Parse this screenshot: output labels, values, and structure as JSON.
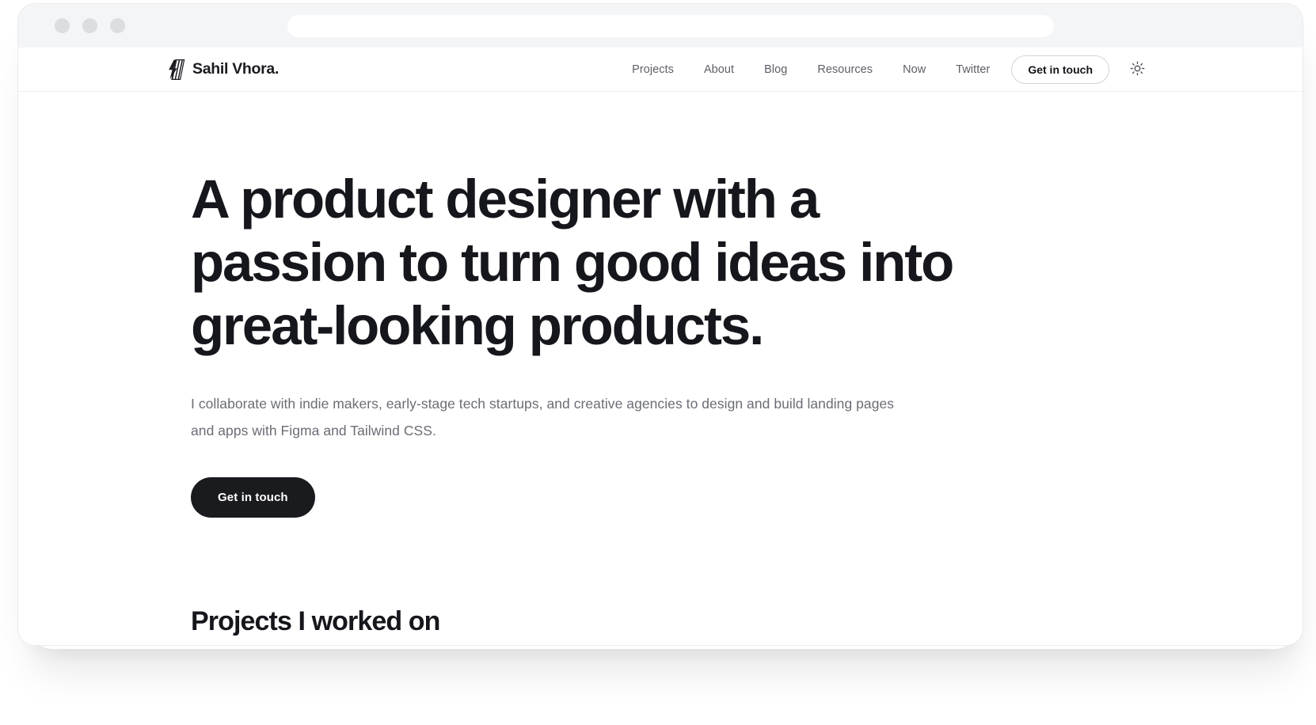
{
  "browser": {
    "traffic_lights": [
      "close",
      "minimize",
      "maximize"
    ],
    "url_value": "",
    "url_placeholder": ""
  },
  "nav": {
    "brand": {
      "logo_icon": "lightning-bolt-logo-icon",
      "name": "Sahil Vhora."
    },
    "links": [
      {
        "label": "Projects"
      },
      {
        "label": "About"
      },
      {
        "label": "Blog"
      },
      {
        "label": "Resources"
      },
      {
        "label": "Now"
      },
      {
        "label": "Twitter"
      }
    ],
    "cta_label": "Get in touch",
    "theme_toggle_icon": "sun-icon"
  },
  "hero": {
    "title": "A product designer with a passion to turn good ideas into great-looking products.",
    "subtitle": "I collaborate with indie makers, early-stage tech startups, and creative agencies to design and build landing pages and apps with Figma and Tailwind CSS.",
    "cta_label": "Get in touch"
  },
  "sections": {
    "projects_title": "Projects I worked on"
  },
  "colors": {
    "ink": "#16171c",
    "muted": "#6b6d75",
    "chrome_bg": "#f4f5f7",
    "dot": "#dcdde0",
    "button_dark": "#1a1b1f"
  }
}
